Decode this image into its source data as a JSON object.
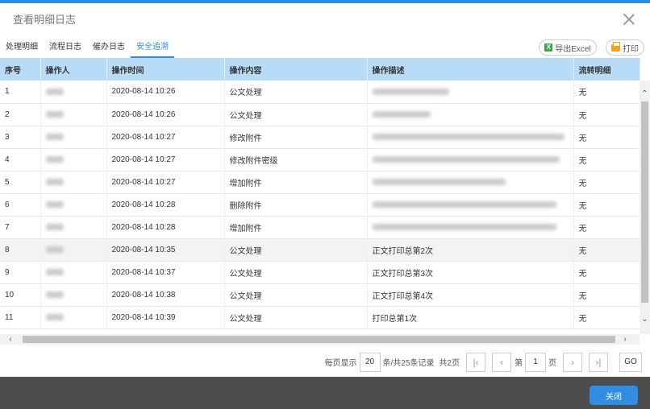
{
  "window": {
    "title": "查看明细日志"
  },
  "tabs": [
    {
      "label": "处理明细"
    },
    {
      "label": "流程日志"
    },
    {
      "label": "催办日志"
    },
    {
      "label": "安全追溯"
    }
  ],
  "toolbar": {
    "export_label": "导出Excel",
    "print_label": "打印"
  },
  "table": {
    "headers": [
      "序号",
      "操作人",
      "操作时间",
      "操作内容",
      "操作描述",
      "流转明细"
    ],
    "rows": [
      {
        "no": "1",
        "time": "2020-08-14 10:26",
        "action": "公文处理",
        "desc": "",
        "flow": "无"
      },
      {
        "no": "2",
        "time": "2020-08-14 10:26",
        "action": "公文处理",
        "desc": "",
        "flow": "无"
      },
      {
        "no": "3",
        "time": "2020-08-14 10:27",
        "action": "修改附件",
        "desc": "",
        "flow": "无"
      },
      {
        "no": "4",
        "time": "2020-08-14 10:27",
        "action": "修改附件密级",
        "desc": "",
        "flow": "无"
      },
      {
        "no": "5",
        "time": "2020-08-14 10:27",
        "action": "增加附件",
        "desc": "",
        "flow": "无"
      },
      {
        "no": "6",
        "time": "2020-08-14 10:28",
        "action": "删除附件",
        "desc": "",
        "flow": "无"
      },
      {
        "no": "7",
        "time": "2020-08-14 10:28",
        "action": "增加附件",
        "desc": "",
        "flow": "无"
      },
      {
        "no": "8",
        "time": "2020-08-14 10:35",
        "action": "公文处理",
        "desc": "正文打印总第2次",
        "flow": "无"
      },
      {
        "no": "9",
        "time": "2020-08-14 10:37",
        "action": "公文处理",
        "desc": "正文打印总第3次",
        "flow": "无"
      },
      {
        "no": "10",
        "time": "2020-08-14 10:38",
        "action": "公文处理",
        "desc": "正文打印总第4次",
        "flow": "无"
      },
      {
        "no": "11",
        "time": "2020-08-14 10:39",
        "action": "公文处理",
        "desc": "打印总第1次",
        "flow": "无"
      }
    ]
  },
  "pagination": {
    "per_page_label": "每页显示",
    "per_page_value": "20",
    "records_text": "条/共25条记录",
    "total_pages_text": "共2页",
    "page_prefix": "第",
    "current_page": "1",
    "page_suffix": "页",
    "go_label": "GO"
  },
  "footer": {
    "close_label": "关闭"
  },
  "colors": {
    "accent": "#2f8de4",
    "header_bg": "#b8dcf7",
    "footer_bg": "#4d4d4d"
  }
}
